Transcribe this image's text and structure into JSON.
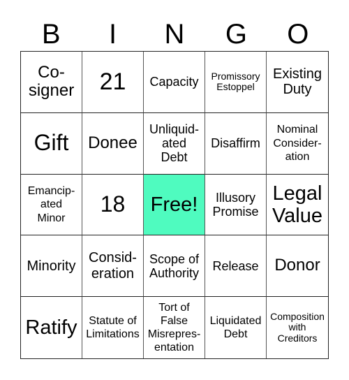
{
  "header": [
    "B",
    "I",
    "N",
    "G",
    "O"
  ],
  "cells": [
    {
      "text": "Co-\nsigner",
      "size": "s24"
    },
    {
      "text": "21",
      "size": "s34"
    },
    {
      "text": "Capacity",
      "size": "s18"
    },
    {
      "text": "Promissory\nEstoppel",
      "size": "s14"
    },
    {
      "text": "Existing\nDuty",
      "size": "s20"
    },
    {
      "text": "Gift",
      "size": "s32"
    },
    {
      "text": "Donee",
      "size": "s24"
    },
    {
      "text": "Unliquid-\nated\nDebt",
      "size": "s18"
    },
    {
      "text": "Disaffirm",
      "size": "s18"
    },
    {
      "text": "Nominal\nConsider-\nation",
      "size": "s16"
    },
    {
      "text": "Emancip-\nated\nMinor",
      "size": "s16"
    },
    {
      "text": "18",
      "size": "s32"
    },
    {
      "text": "Free!",
      "size": "s29",
      "free": true
    },
    {
      "text": "Illusory\nPromise",
      "size": "s18"
    },
    {
      "text": "Legal\nValue",
      "size": "s29"
    },
    {
      "text": "Minority",
      "size": "s20"
    },
    {
      "text": "Consid-\neration",
      "size": "s20"
    },
    {
      "text": "Scope of\nAuthority",
      "size": "s18"
    },
    {
      "text": "Release",
      "size": "s18"
    },
    {
      "text": "Donor",
      "size": "s24"
    },
    {
      "text": "Ratify",
      "size": "s29"
    },
    {
      "text": "Statute of\nLimitations",
      "size": "s16"
    },
    {
      "text": "Tort of\nFalse\nMisrepres-\nentation",
      "size": "s16"
    },
    {
      "text": "Liquidated\nDebt",
      "size": "s16"
    },
    {
      "text": "Composition\nwith\nCreditors",
      "size": "s14"
    }
  ],
  "colors": {
    "free_cell": "#4ffbbf"
  }
}
